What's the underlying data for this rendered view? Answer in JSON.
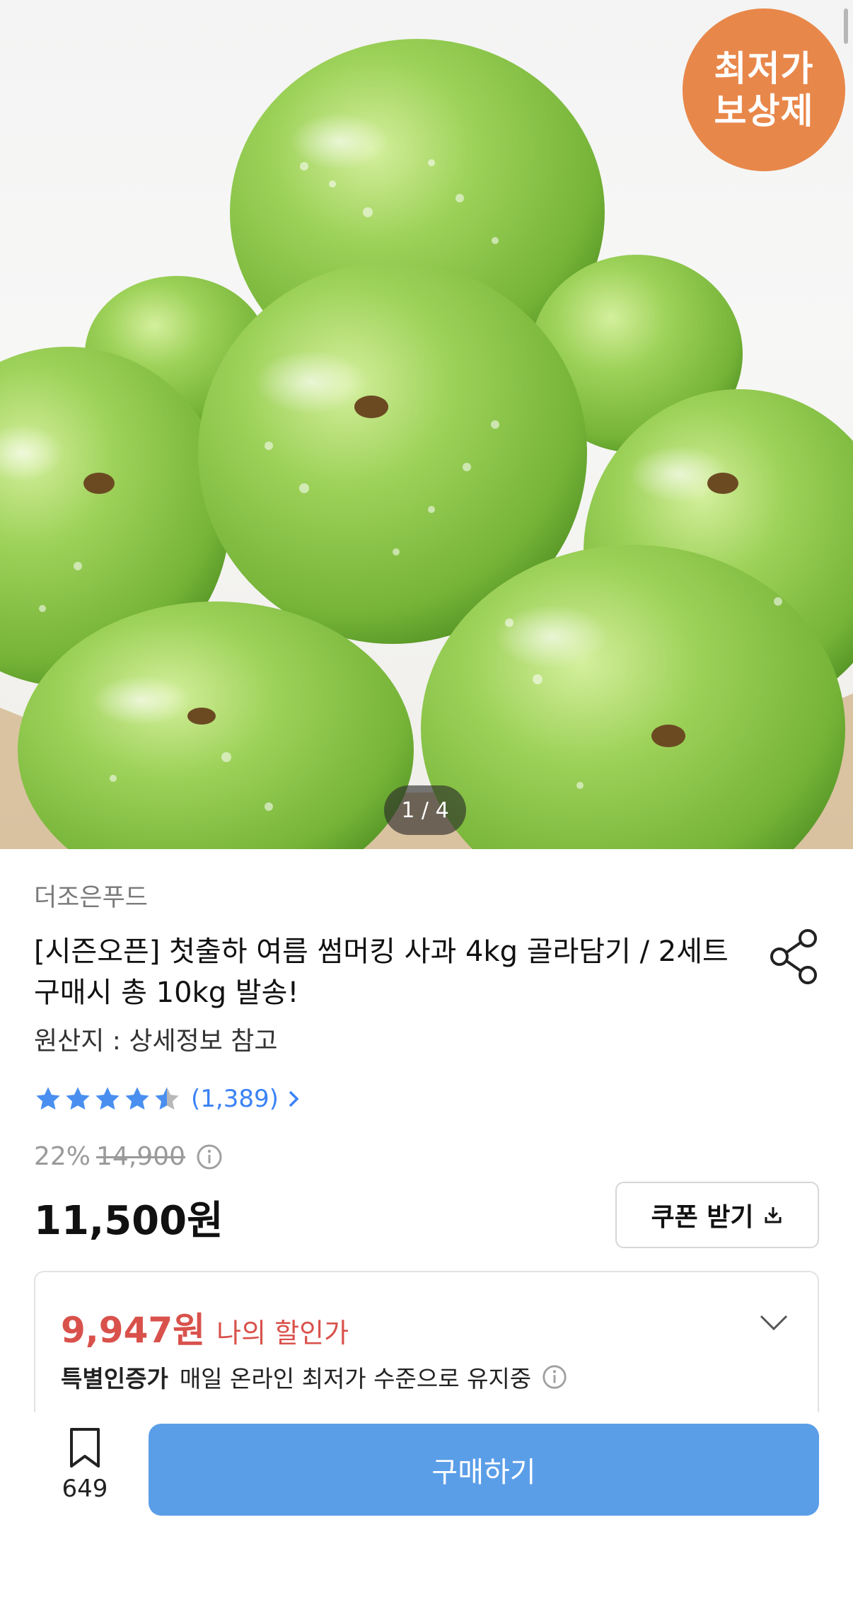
{
  "hero": {
    "badge_line1": "최저가",
    "badge_line2": "보상제",
    "pager": "1 / 4",
    "badge_color": "#e8874a"
  },
  "product": {
    "seller": "더조은푸드",
    "title": "[시즌오픈] 첫출하 여름 썸머킹 사과 4kg 골라담기 / 2세트 구매시 총 10kg 발송!",
    "origin": "원산지 : 상세정보 참고",
    "rating_stars": 4.5,
    "review_count": "(1,389)",
    "discount_rate": "22%",
    "original_price": "14,900",
    "price": "11,500원"
  },
  "coupon": {
    "label": "쿠폰 받기"
  },
  "my_discount": {
    "amount": "9,947원",
    "label": "나의 할인가",
    "cert_title": "특별인증가",
    "cert_text": "매일 온라인 최저가 수준으로 유지중"
  },
  "bottom_bar": {
    "bookmark_count": "649",
    "buy_label": "구매하기",
    "buy_color": "#5b9ee8"
  },
  "colors": {
    "accent_blue": "#3b82f6",
    "discount_red": "#d9514b",
    "star_blue": "#4a8ff0"
  }
}
